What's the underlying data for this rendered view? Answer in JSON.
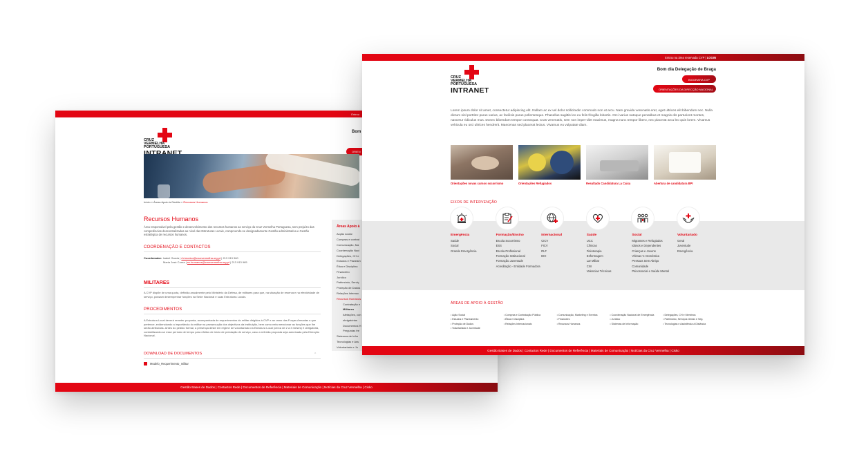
{
  "back_page": {
    "topbar_text": "Entrou",
    "greeting": "Bom",
    "pill_text": "ORIEN",
    "logo": {
      "line1": "CRUZ",
      "line2": "VERMELHA",
      "line3": "PORTUGUESA",
      "intranet": "INTRANET"
    },
    "breadcrumb": {
      "home": "Início",
      "sep1": " » ",
      "area": "Áreas Apoio à Gestão",
      "sep2": " » ",
      "current": "Recursos Humanos"
    },
    "title": "Recursos Humanos",
    "intro": "Área responsável pela gestão e desenvolvimento dos recursos humanos ao serviço da Cruz Vermelha Portuguesa, sem prejuízo das competências descentralizadas ao nível das Estruturas Locais, compreendo-se designadamente Gestão administrativa e Gestão estratégica de recursos humanos.",
    "coord_heading": "COORDENAÇÃO E CONTACTOS",
    "coordinator_label": "Coordenador:",
    "coordinator_line1_name": "Isabel Garcia",
    "coordinator_line1_email": "rh.tecnico@cruzvermelha.org.pt",
    "coordinator_line1_phone": "213 913 960",
    "coordinator_line2_name": "Maria José Corea",
    "coordinator_line2_email": "ec.humanos@cruzvermelha.org.pt",
    "coordinator_line2_phone": "213 913 965",
    "militares_heading": "MILITARES",
    "militares_text": "A CVP dispõe de uma quota, definida anualmente pelo Ministério da Defesa, de militares para que, na situação de reserva e na efectividade de serviço, possam desempenhar funções na Sede Nacional e suas Estruturas Locais.",
    "proc_heading": "PROCEDIMENTOS",
    "proc_text": "A Estrutura Local deverá remeter proposta, acompanhada de requerimentos do militar dirigidos à CVP e ao ramo das Forças Armadas a que pertence, evidenciando a importância do militar na prossecução dos objectivos da instituição, bem como nela mencionar as funções que lhe serão atribuídas. Antes do pedido formal, a presença deste em regime de voluntariado na Estrutura Local (cerca de 2 a 3 meses) é obrigatória, contabilizando-se esse período de tempo para efeitos de início de prestação de serviço, caso a referida proposta seja autorizada pela Direcção Nacional.",
    "download_heading": "DOWNLOAD DE DOCUMENTOS",
    "download_file": "Modelo_Requerimento_militar",
    "sidebar": {
      "title": "Áreas Apoio à",
      "items": [
        "Acção social",
        "Compras e contrat",
        "Comunicação, Ma",
        "Coordenação Naci",
        "Delegações, CH e",
        "Estudos e Planeam",
        "Ética e Disciplina",
        "Financeiro",
        "Jurídico",
        "Património, Serviç",
        "Proteção de Dados",
        "Relações Internac",
        "Recursos Humanos",
        "Contratação e",
        "Militares",
        "Afetações, con",
        "obrigatórias",
        "Documentos H",
        "Perguntas fre",
        "Sistemas de Infor",
        "Tecnologias e Ass",
        "Voluntariado e Ju"
      ]
    },
    "footer": "Gestão Bases de Dados  |  Contactos Rede  |  Documentos de Referência  |  Materiais de Comunicação  |  Notícias da Cruz Vermelha  |  Cisko"
  },
  "front_page": {
    "topbar_prefix": "Entrou na área reservada CVP  |  ",
    "topbar_login": "LOGIN",
    "logo": {
      "line1": "CRUZ",
      "line2": "VERMELHA",
      "line3": "PORTUGUESA",
      "intranet": "INTRANET"
    },
    "greeting": "Bom dia Delegação de Braga",
    "button1": "BIOGRAFIA CVP",
    "button2": "ORIENTAÇÕES DA DIRECÇÃO NACIONAL",
    "intro": "Lorem ipsum dolor sit amet, consectetur adipiscing elit. Nullam ac ex vel dolor sollicitudin commodo non ut arcu. Nam gravida venenatis erat, eget ultrices elit bibendum nec. Nulla dictum nisl porttitor purus varius, ac facilisis purus pellentesque. Phasellus sagittis leo eu felis fringilla lobortis. Orci varius natoque penatibus et magnis dis parturient montes, nascetur ridiculus mus. Donec bibendum tempor consequat. Cras venenatis, sem non imper-diet maximus, magna nunc tempor libero, nec placerat arcu leo quis lorem. Vivamus vehicula eu orci ultrices hendrerit. Maecenas sed placerat lectus. Vivamus eu vulputate diam.",
    "cards": [
      {
        "caption": "Orientações novas cursos socorrismo"
      },
      {
        "caption": "Orientações Refugiados"
      },
      {
        "caption": "Resultado Candidatura La Caixa"
      },
      {
        "caption": "Abertura de candidatura BPI"
      }
    ],
    "eixos_heading": "EIXOS DE INTERVENÇÃO",
    "areas": [
      {
        "icon": "siren-icon",
        "title": "Emergência",
        "items": [
          "Saúde",
          "Social",
          "Grande Emergência"
        ]
      },
      {
        "icon": "clipboard-icon",
        "title": "Formação/Ensino",
        "items": [
          "Escola Socorrismo",
          "ESS",
          "Escola Profissional",
          "Formação Institucional",
          "Formação Juventude",
          "Acreditação - Entidade Formadora"
        ]
      },
      {
        "icon": "globe-icon",
        "title": "Internacional",
        "items": [
          "CICV",
          "FICV",
          "RLF",
          "DIH"
        ]
      },
      {
        "icon": "heart-icon",
        "title": "Saúde",
        "items": [
          "UCC",
          "Clínicas",
          "Fisioterapia",
          "Enfermagem",
          "Lar Militar",
          "CNI",
          "Valencias Técnicas"
        ]
      },
      {
        "icon": "people-icon",
        "title": "Social",
        "items": [
          "Migrantes e Refugiados",
          "Idosos e Dependentes",
          "Crianças e Jovens",
          "Vítimas V. Doméstica",
          "Pessoas Sem Abrigo",
          "Comunidade",
          "Psicossocial e Saúde Mental"
        ]
      },
      {
        "icon": "hands-cross-icon",
        "title": "Voluntariado",
        "items": [
          "Geral",
          "Juventude",
          "Emergência"
        ]
      }
    ],
    "apoio_heading": "ÁREAS DE APOIO À GESTÃO",
    "apoio_cols": [
      [
        "Ação Social",
        "Estudos e Planeamento",
        "Proteção de Dados",
        "Voluntariado e Juventude"
      ],
      [
        "Compras e Contratação Pública",
        "Ética e Disciplina",
        "Relações Internacionais"
      ],
      [
        "Comunicação, Marketing e Eventos",
        "Financeiro",
        "Recursos Humanos"
      ],
      [
        "Coordenação Nacional de Emergência",
        "Jurídico",
        "Sistemas de Informação"
      ],
      [
        "Delegações, CH e Membros",
        "Património, Serviços Gerais e Seg.",
        "Tecnologias e Assistência à Distância"
      ]
    ],
    "footer": "Gestão Bases de Dados  |  Contactos Rede  |  Documentos de Referência  |  Materiais de Comunicação  |  Notícias da Cruz Vermelha  |  Cisko"
  },
  "colors": {
    "brand_red": "#e30613",
    "dark_red": "#8c0d12",
    "band_gray": "#e9e9e9"
  }
}
